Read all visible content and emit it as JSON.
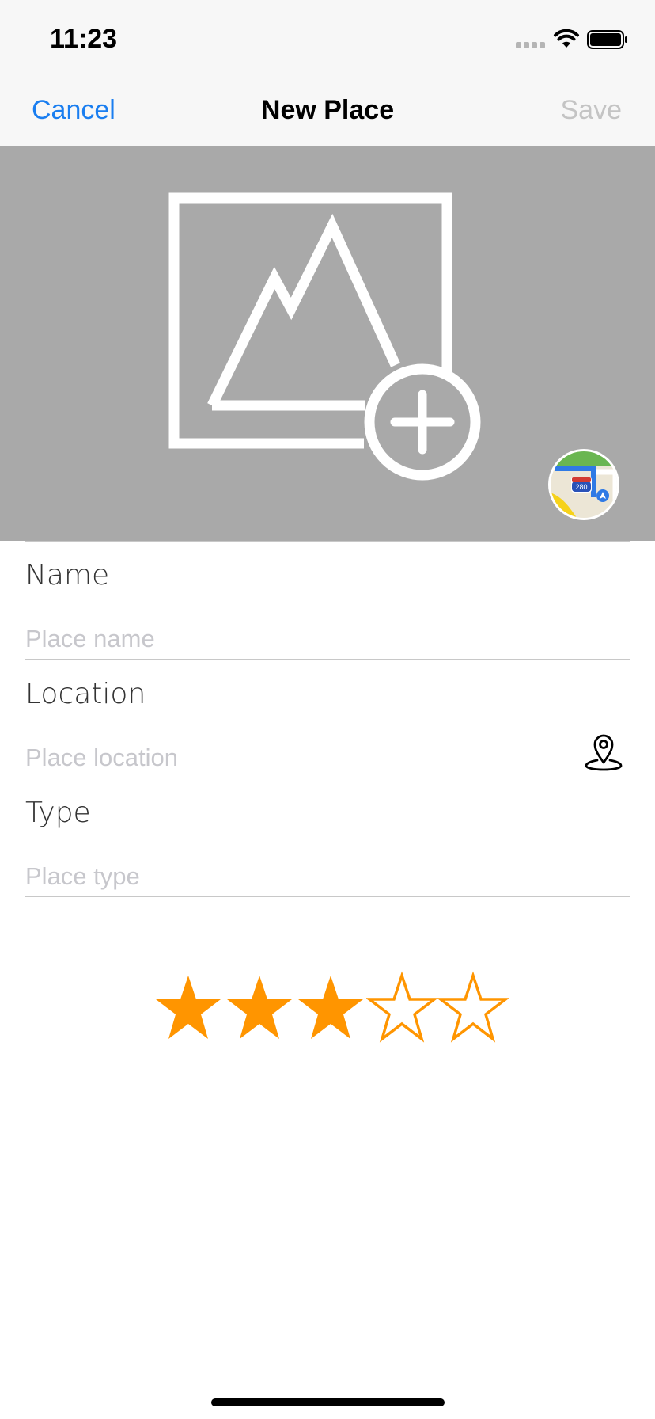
{
  "status_bar": {
    "time": "11:23"
  },
  "nav": {
    "cancel_label": "Cancel",
    "title": "New Place",
    "save_label": "Save"
  },
  "form": {
    "name": {
      "label": "Name",
      "placeholder": "Place name",
      "value": ""
    },
    "location": {
      "label": "Location",
      "placeholder": "Place location",
      "value": ""
    },
    "type": {
      "label": "Type",
      "placeholder": "Place type",
      "value": ""
    }
  },
  "map_button": {
    "shield_text": "280"
  },
  "rating": {
    "value": 3,
    "max": 5
  },
  "colors": {
    "accent": "#1a7ef0",
    "disabled": "#c4c4c4",
    "image_bg": "#a9a9a9",
    "star": "#ff9500"
  }
}
